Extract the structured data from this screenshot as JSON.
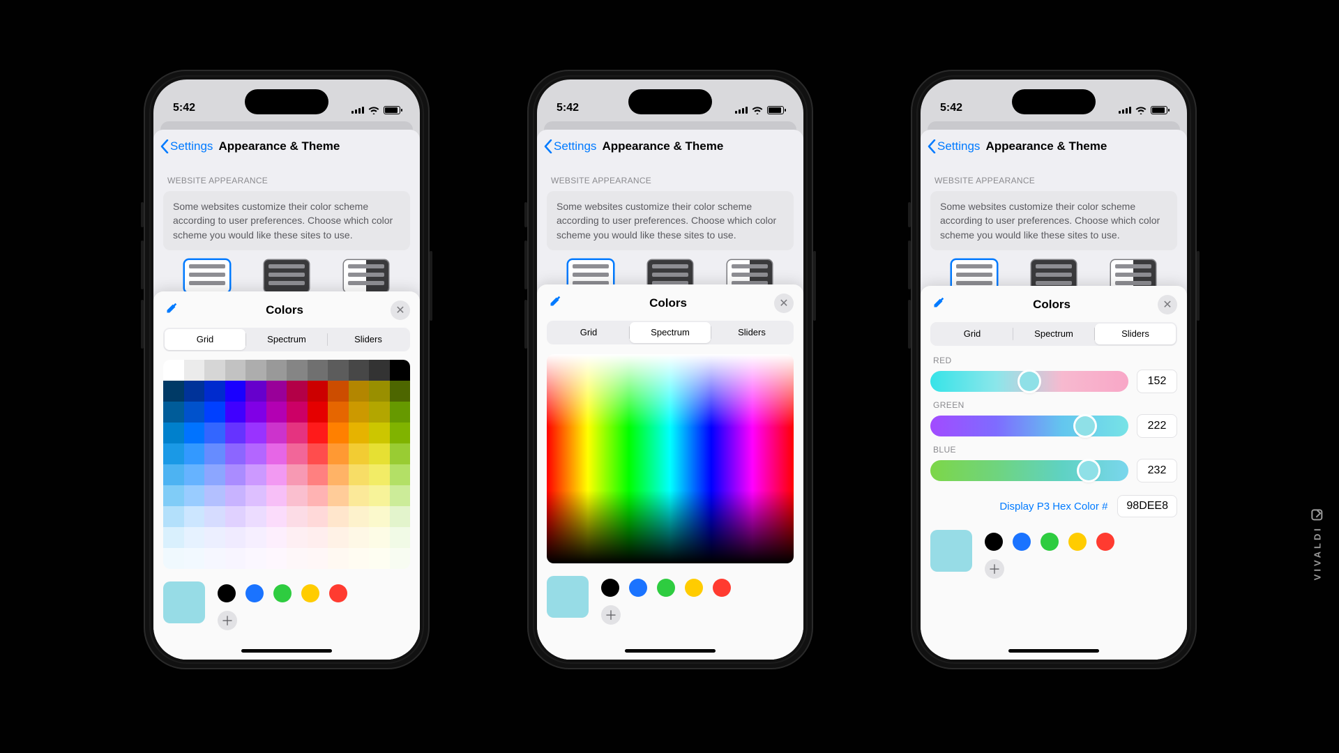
{
  "status": {
    "time": "5:42"
  },
  "nav": {
    "back_label": "Settings",
    "title": "Appearance & Theme"
  },
  "section": {
    "label": "WEBSITE APPEARANCE",
    "info": "Some websites customize their color scheme according to user preferences. Choose which color scheme you would like these sites to use."
  },
  "sheet": {
    "title": "Colors",
    "tabs": {
      "grid": "Grid",
      "spectrum": "Spectrum",
      "sliders": "Sliders"
    }
  },
  "sliders": {
    "red": {
      "label": "RED",
      "value": "152",
      "pct": 50
    },
    "green": {
      "label": "GREEN",
      "value": "222",
      "pct": 78
    },
    "blue": {
      "label": "BLUE",
      "value": "232",
      "pct": 80
    },
    "hex_label": "Display P3 Hex Color #",
    "hex_value": "98DEE8"
  },
  "swatch": {
    "current": "#97dce6",
    "presets": [
      "#000000",
      "#1a73ff",
      "#2ecc40",
      "#ffcc00",
      "#ff3b30"
    ]
  },
  "watermark": "VIVALDI",
  "grid_colors": [
    [
      "#ffffff",
      "#ebebeb",
      "#d6d6d6",
      "#c2c2c2",
      "#adadad",
      "#999999",
      "#858585",
      "#707070",
      "#5c5c5c",
      "#474747",
      "#333333",
      "#000000"
    ],
    [
      "#003a66",
      "#003399",
      "#002bce",
      "#1a00ff",
      "#6600cc",
      "#990099",
      "#b30047",
      "#cc0000",
      "#cc4d00",
      "#b38600",
      "#998f00",
      "#4d6600"
    ],
    [
      "#005c99",
      "#0052cc",
      "#0040ff",
      "#4000ff",
      "#8000e6",
      "#b300b3",
      "#cc0066",
      "#e50000",
      "#e66600",
      "#cc9900",
      "#b3a600",
      "#669900"
    ],
    [
      "#0080cc",
      "#0073ff",
      "#3366ff",
      "#6633ff",
      "#9933ff",
      "#cc33cc",
      "#e53380",
      "#ff1a1a",
      "#ff8000",
      "#e6b300",
      "#ccc600",
      "#80b300"
    ],
    [
      "#1a99e6",
      "#3399ff",
      "#668cff",
      "#8c66ff",
      "#b366ff",
      "#e666e6",
      "#f26699",
      "#ff4d4d",
      "#ff9933",
      "#f2cc33",
      "#e6e033",
      "#99cc33"
    ],
    [
      "#4db3f2",
      "#66b3ff",
      "#8ca6ff",
      "#aa8cff",
      "#cc99ff",
      "#f299f2",
      "#f799b3",
      "#ff8080",
      "#ffb366",
      "#f7dd66",
      "#f2ec66",
      "#b3e066"
    ],
    [
      "#80ccf7",
      "#99ccff",
      "#b3c0ff",
      "#c8b3ff",
      "#ddbfff",
      "#f7bff7",
      "#fabfcf",
      "#ffb3b3",
      "#ffcc99",
      "#fbe999",
      "#f7f399",
      "#ccec99"
    ],
    [
      "#b3e0fb",
      "#cce6ff",
      "#d6dcff",
      "#e0d1ff",
      "#ecdcff",
      "#fbdcfb",
      "#fcdce6",
      "#ffd9d9",
      "#ffe6cc",
      "#fdf2cc",
      "#fbf9cc",
      "#e3f4cc"
    ],
    [
      "#d9f0fd",
      "#e6f2ff",
      "#ecefff",
      "#f0ebff",
      "#f6efff",
      "#fdeffd",
      "#feeff3",
      "#ffeeee",
      "#fff2e6",
      "#fef8e6",
      "#fdfce6",
      "#f1fae6"
    ],
    [
      "#f0f9fe",
      "#f2f9ff",
      "#f6f7ff",
      "#f8f5ff",
      "#fbf7ff",
      "#fef7fe",
      "#fef7f9",
      "#fff7f7",
      "#fff9f2",
      "#fffcf2",
      "#fefef2",
      "#f8fcf2"
    ]
  ]
}
